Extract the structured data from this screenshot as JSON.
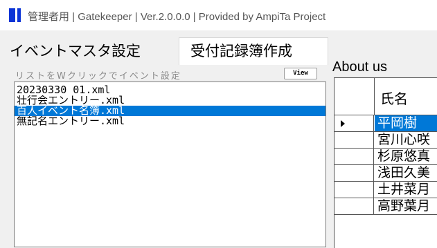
{
  "window": {
    "title": "管理者用 | Gatekeeper | Ver.2.0.0.0 | Provided by AmpiTa Project",
    "icon": "app-logo-icon",
    "accent": "#0a34d6"
  },
  "tabs": [
    {
      "label": "イベントマスタ設定",
      "active": false
    },
    {
      "label": "受付記録簿作成",
      "active": true
    },
    {
      "label": "About us",
      "active": false
    }
  ],
  "event_list": {
    "hint": "リストをWクリックでイベント設定",
    "view_label": "View",
    "items": [
      {
        "label": "20230330_01.xml",
        "selected": false
      },
      {
        "label": "壮行会エントリー.xml",
        "selected": false
      },
      {
        "label": "百人イベント名簿.xml",
        "selected": true
      },
      {
        "label": "無記名エントリー.xml",
        "selected": false
      }
    ]
  },
  "grid": {
    "header": "氏名",
    "rows": [
      "平岡樹",
      "宮川心咲",
      "杉原悠真",
      "浅田久美",
      "土井菜月",
      "高野葉月"
    ],
    "current_row": 0,
    "selection_color": "#0078d7"
  }
}
